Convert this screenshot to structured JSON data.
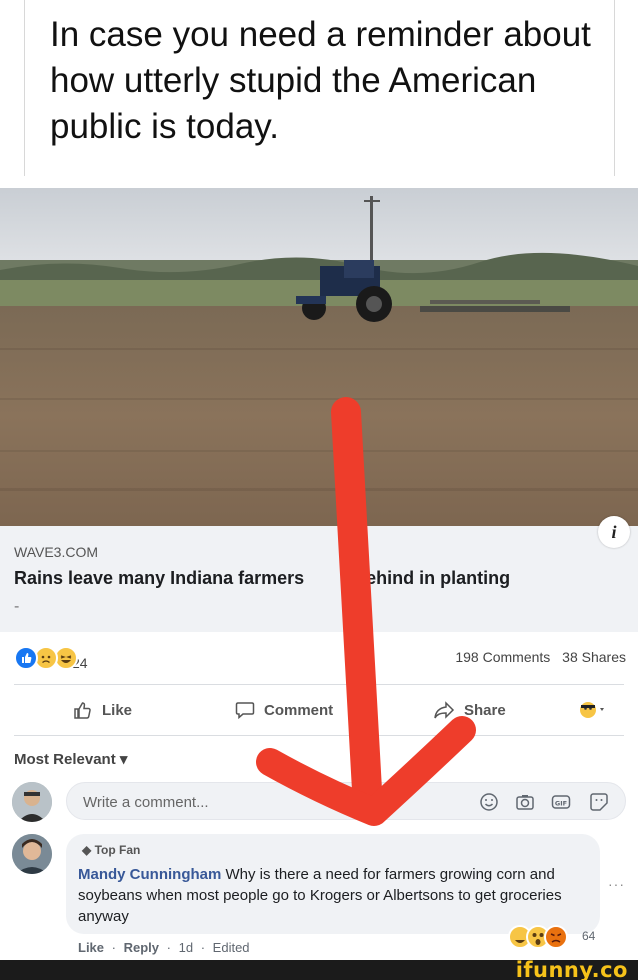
{
  "meme_caption": "In case you need a reminder about how utterly stupid the American public is today.",
  "post": {
    "source": "WAVE3.COM",
    "title": "Rains leave many Indiana farmers    ll behind in planting",
    "title_tail": "-",
    "info_label": "i",
    "reaction_count": "24",
    "comments_count": "198 Comments",
    "shares_count": "38 Shares",
    "reaction_icons": [
      "like-reaction",
      "sad-reaction",
      "haha-reaction"
    ],
    "actions": {
      "like": "Like",
      "comment": "Comment",
      "share": "Share"
    },
    "sort_label": "Most Relevant ▾",
    "comment_placeholder": "Write a comment...",
    "input_icons": [
      "emoji-icon",
      "camera-icon",
      "gif-icon",
      "sticker-icon"
    ]
  },
  "comment": {
    "badge": "Top Fan",
    "author": "Mandy Cunningham",
    "text": " Why is there a need for farmers growing corn and soybeans when most people go to Krogers or Albertsons to get groceries anyway",
    "like": "Like",
    "reply": "Reply",
    "time": "1d",
    "edited": "Edited",
    "reaction_count": "64",
    "more": "···"
  },
  "watermark": "ifunny.co",
  "colors": {
    "arrow": "#ee3d2b",
    "link_card_bg": "#f0f2f5",
    "author_blue": "#385898",
    "facebook_blue": "#1877f2",
    "watermark_yellow": "#f6c21a"
  }
}
